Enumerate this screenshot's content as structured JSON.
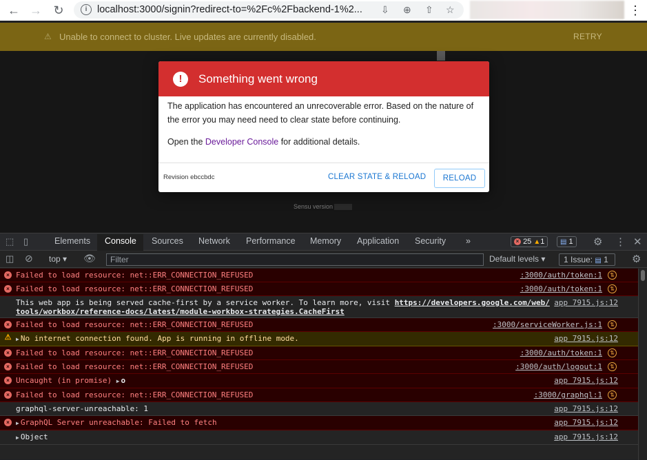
{
  "browser": {
    "url": "localhost:3000/signin?redirect-to=%2Fc%2Fbackend-1%2..."
  },
  "banner": {
    "message": "Unable to connect to cluster. Live updates are currently disabled.",
    "retry_label": "RETRY"
  },
  "dialog": {
    "title": "Something went wrong",
    "body_1": "The application has encountered an unrecoverable error. Based on the nature of the error you may need need to clear state before continuing.",
    "body_2_pre": "Open the ",
    "body_2_link": "Developer Console",
    "body_2_post": " for additional details.",
    "revision": "Revision ebccbdc",
    "clear_label": "CLEAR STATE & RELOAD",
    "reload_label": "RELOAD"
  },
  "app": {
    "version_label": "Sensu version"
  },
  "devtools": {
    "tabs": [
      "Elements",
      "Console",
      "Sources",
      "Network",
      "Performance",
      "Memory",
      "Application",
      "Security"
    ],
    "more": "»",
    "error_count": "25",
    "warning_count": "1",
    "message_count": "1",
    "context": "top",
    "filter_placeholder": "Filter",
    "levels_label": "Default levels",
    "issues_label": "1 Issue:",
    "issues_count": "1"
  },
  "console": {
    "rows": [
      {
        "level": "error",
        "text": "Failed to load resource: net::ERR_CONNECTION_REFUSED",
        "source": ":3000/auth/token:1"
      },
      {
        "level": "error",
        "text": "Failed to load resource: net::ERR_CONNECTION_REFUSED",
        "source": ":3000/auth/token:1"
      },
      {
        "level": "info",
        "text_pre": "This web app is being served cache-first by a service worker. To learn more, visit ",
        "link_1": "https://developers.google.com/web/",
        "link_2": "tools/workbox/reference-docs/latest/module-workbox-strategies.CacheFirst",
        "source": "app 7915.js:12"
      },
      {
        "level": "error",
        "text": "Failed to load resource: net::ERR_CONNECTION_REFUSED",
        "source": ":3000/serviceWorker.js:1"
      },
      {
        "level": "warning",
        "text": "No internet connection found. App is running in offline mode.",
        "source": "app 7915.js:12"
      },
      {
        "level": "error",
        "text": "Failed to load resource: net::ERR_CONNECTION_REFUSED",
        "source": ":3000/auth/token:1"
      },
      {
        "level": "error",
        "text": "Failed to load resource: net::ERR_CONNECTION_REFUSED",
        "source": ":3000/auth/logout:1"
      },
      {
        "level": "error",
        "text": "Uncaught (in promise) ",
        "obj": "o",
        "source": "app 7915.js:12"
      },
      {
        "level": "error",
        "text": "Failed to load resource: net::ERR_CONNECTION_REFUSED",
        "source": ":3000/graphql:1"
      },
      {
        "level": "info",
        "text": "graphql-server-unreachable: 1",
        "source": "app 7915.js:12"
      },
      {
        "level": "error",
        "text": "GraphQL Server unreachable:  Failed to fetch",
        "source": "app 7915.js:12"
      },
      {
        "level": "info",
        "text": "Object",
        "source": "app 7915.js:12"
      }
    ]
  }
}
